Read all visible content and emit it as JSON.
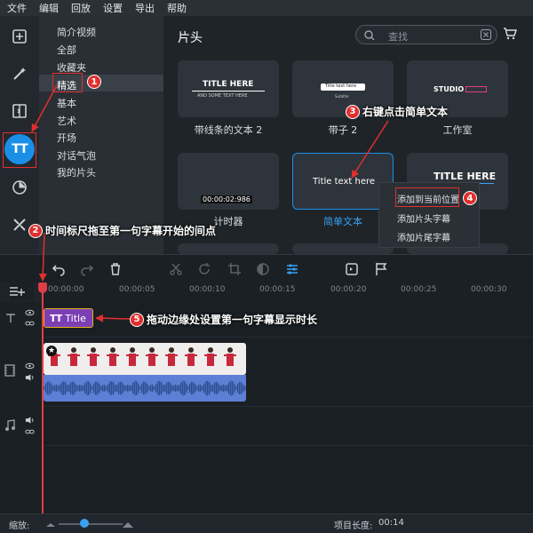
{
  "menu": [
    "文件",
    "编辑",
    "回放",
    "设置",
    "导出",
    "帮助"
  ],
  "left_tools": [
    {
      "icon": "add-file-icon"
    },
    {
      "icon": "magic-wand-icon"
    },
    {
      "icon": "transition-icon"
    },
    {
      "icon": "titles-icon",
      "label": "TT",
      "active": true
    },
    {
      "icon": "sticker-icon"
    },
    {
      "icon": "tools-icon"
    }
  ],
  "categories": [
    "简介视频",
    "全部",
    "收藏夹",
    "精选",
    "基本",
    "艺术",
    "开场",
    "对话气泡",
    "我的片头"
  ],
  "selected_category": "精选",
  "gallery": {
    "title": "片头",
    "search_placeholder": "查找",
    "items": [
      {
        "caption": "带线条的文本 2",
        "preview": [
          "TITLE HERE",
          "AND SOME TEXT HERE"
        ]
      },
      {
        "caption": "带子 2",
        "preview": [
          "Title text here",
          "Subtitle"
        ]
      },
      {
        "caption": "工作室",
        "preview": [
          "STUDIO"
        ]
      },
      {
        "caption": "计时器",
        "preview": [
          "00:00:02:986"
        ]
      },
      {
        "caption": "简单文本",
        "preview": [
          "Title text here"
        ],
        "selected": true
      },
      {
        "caption": "",
        "preview": [
          "TITLE HERE"
        ]
      }
    ]
  },
  "context_menu": [
    "添加到当前位置",
    "添加片头字幕",
    "添加片尾字幕"
  ],
  "timeline": {
    "ticks": [
      "00:00:00",
      "00:00:05",
      "00:00:10",
      "00:00:15",
      "00:00:20",
      "00:00:25",
      "00:00:30"
    ],
    "title_clip_label": "Title",
    "title_clip_icon": "TT"
  },
  "status": {
    "zoom_label": "缩放:",
    "zoom_level": 0.4,
    "length_label": "项目长度:",
    "length_value": "00:14"
  },
  "annotations": [
    {
      "num": "1",
      "text": ""
    },
    {
      "num": "2",
      "text": "时间标尺拖至第一句字幕开始的间点"
    },
    {
      "num": "3",
      "text": "右键点击简单文本"
    },
    {
      "num": "4",
      "text": ""
    },
    {
      "num": "5",
      "text": "拖动边缘处设置第一句字幕显示时长"
    }
  ],
  "colors": {
    "accent": "#1a8fe8",
    "annotation_red": "#e0302e",
    "title_clip": "#7b3fb3",
    "video_clip": "#2c4d8c",
    "audio_clip": "#5d7fd6",
    "playhead": "#e03e46"
  }
}
